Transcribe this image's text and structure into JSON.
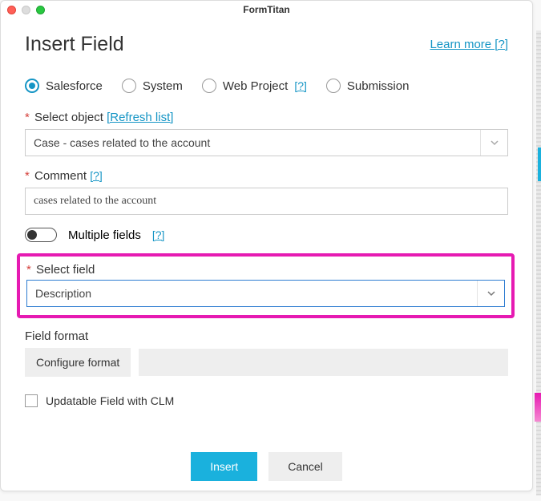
{
  "window": {
    "title": "FormTitan"
  },
  "header": {
    "title": "Insert Field",
    "learn_more": "Learn more [?]"
  },
  "source": {
    "options": [
      "Salesforce",
      "System",
      "Web Project",
      "Submission"
    ],
    "web_project_help": "[?]",
    "selected_index": 0
  },
  "select_object": {
    "label": "Select object",
    "refresh": "[Refresh list]",
    "value": "Case - cases related to the account"
  },
  "comment": {
    "label": "Comment",
    "help": "[?]",
    "value": "cases related to the account"
  },
  "multiple_fields": {
    "label": "Multiple fields",
    "help": "[?]"
  },
  "select_field": {
    "label": "Select field",
    "value": "Description"
  },
  "field_format": {
    "label": "Field format",
    "configure": "Configure format"
  },
  "updatable": {
    "label": "Updatable Field with CLM"
  },
  "footer": {
    "insert": "Insert",
    "cancel": "Cancel"
  }
}
